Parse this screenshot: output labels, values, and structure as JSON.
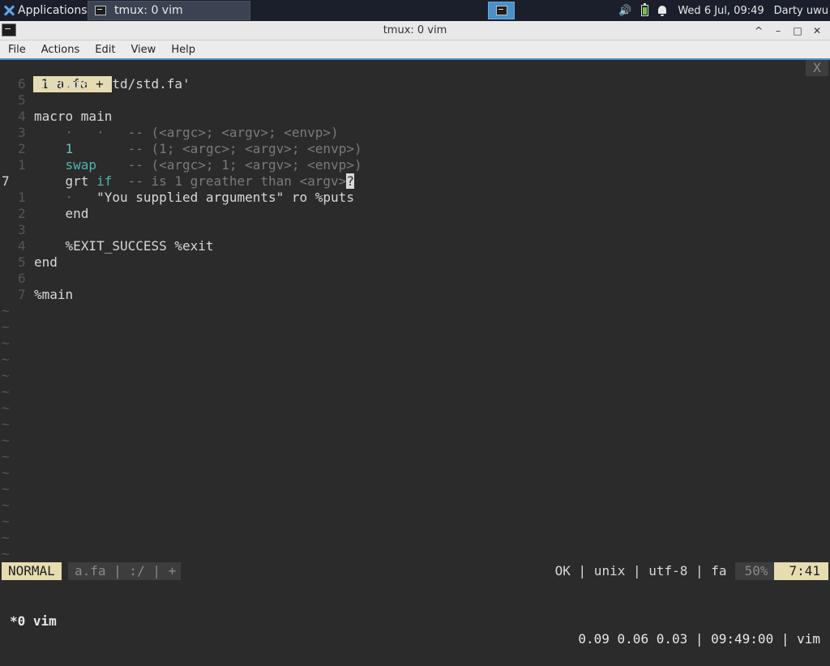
{
  "taskbar": {
    "applications_label": "Applications",
    "task_title": "tmux: 0 vim",
    "clock": "Wed  6 Jul, 09:49",
    "user": "Darty uwu",
    "icons": [
      "xfce-menu-icon",
      "terminal-icon",
      "volume-icon",
      "battery-icon",
      "bell-icon"
    ]
  },
  "window": {
    "title": "tmux: 0 vim",
    "buttons": [
      "^",
      "–",
      "□",
      "✕"
    ]
  },
  "menu": {
    "items": [
      "File",
      "Actions",
      "Edit",
      "View",
      "Help"
    ]
  },
  "vim": {
    "tab": {
      "label": "1 a.fa +",
      "close": "X"
    },
    "lines": [
      {
        "num": "6",
        "parts": [
          {
            "t": "include 'std/std.fa'",
            "c": ""
          }
        ]
      },
      {
        "num": "5",
        "parts": []
      },
      {
        "num": "4",
        "parts": [
          {
            "t": "macro main",
            "c": ""
          }
        ]
      },
      {
        "num": "3",
        "parts": [
          {
            "t": "    ·   ·   ",
            "c": "dim"
          },
          {
            "t": "-- (<argc>; <argv>; <envp>)",
            "c": "cmt"
          }
        ]
      },
      {
        "num": "2",
        "parts": [
          {
            "t": "    ",
            "c": ""
          },
          {
            "t": "1",
            "c": "num"
          },
          {
            "t": "       ",
            "c": ""
          },
          {
            "t": "-- (1; <argc>; <argv>; <envp>)",
            "c": "cmt"
          }
        ]
      },
      {
        "num": "1",
        "parts": [
          {
            "t": "    ",
            "c": ""
          },
          {
            "t": "swap",
            "c": "kw"
          },
          {
            "t": "    ",
            "c": ""
          },
          {
            "t": "-- (<argc>; 1; <argv>; <envp>)",
            "c": "cmt"
          }
        ]
      },
      {
        "num": "7",
        "cur": true,
        "parts": [
          {
            "t": "    grt ",
            "c": ""
          },
          {
            "t": "if",
            "c": "kw"
          },
          {
            "t": "  ",
            "c": ""
          },
          {
            "t": "-- is 1 greather than <argv>",
            "c": "cmt"
          },
          {
            "t": "?",
            "c": "cursor"
          }
        ]
      },
      {
        "num": "1",
        "parts": [
          {
            "t": "    ·   ",
            "c": "dim"
          },
          {
            "t": "\"You supplied arguments\" ro %puts",
            "c": ""
          }
        ]
      },
      {
        "num": "2",
        "parts": [
          {
            "t": "    end",
            "c": ""
          }
        ]
      },
      {
        "num": "3",
        "parts": []
      },
      {
        "num": "4",
        "parts": [
          {
            "t": "    %EXIT_SUCCESS %exit",
            "c": ""
          }
        ]
      },
      {
        "num": "5",
        "parts": [
          {
            "t": "end",
            "c": ""
          }
        ]
      },
      {
        "num": "6",
        "parts": []
      },
      {
        "num": "7",
        "parts": [
          {
            "t": "%main",
            "c": ""
          }
        ]
      }
    ],
    "tilde_count": 16,
    "tilde_char": "~",
    "statusline": {
      "mode": "NORMAL",
      "file_section": "a.fa | :/ | +",
      "info": "OK | unix | utf-8 | fa",
      "percent": "50%",
      "position": "7:41"
    }
  },
  "tmux": {
    "window_label": "*0 vim",
    "status_right": "0.09 0.06 0.03 | 09:49:00 | vim"
  },
  "colors": {
    "background": "#2b2b2b",
    "keyword": "#4ab6b4",
    "comment": "#7a7a7a",
    "status_accent": "#e5dcb0",
    "window_border": "#4a90c8"
  }
}
